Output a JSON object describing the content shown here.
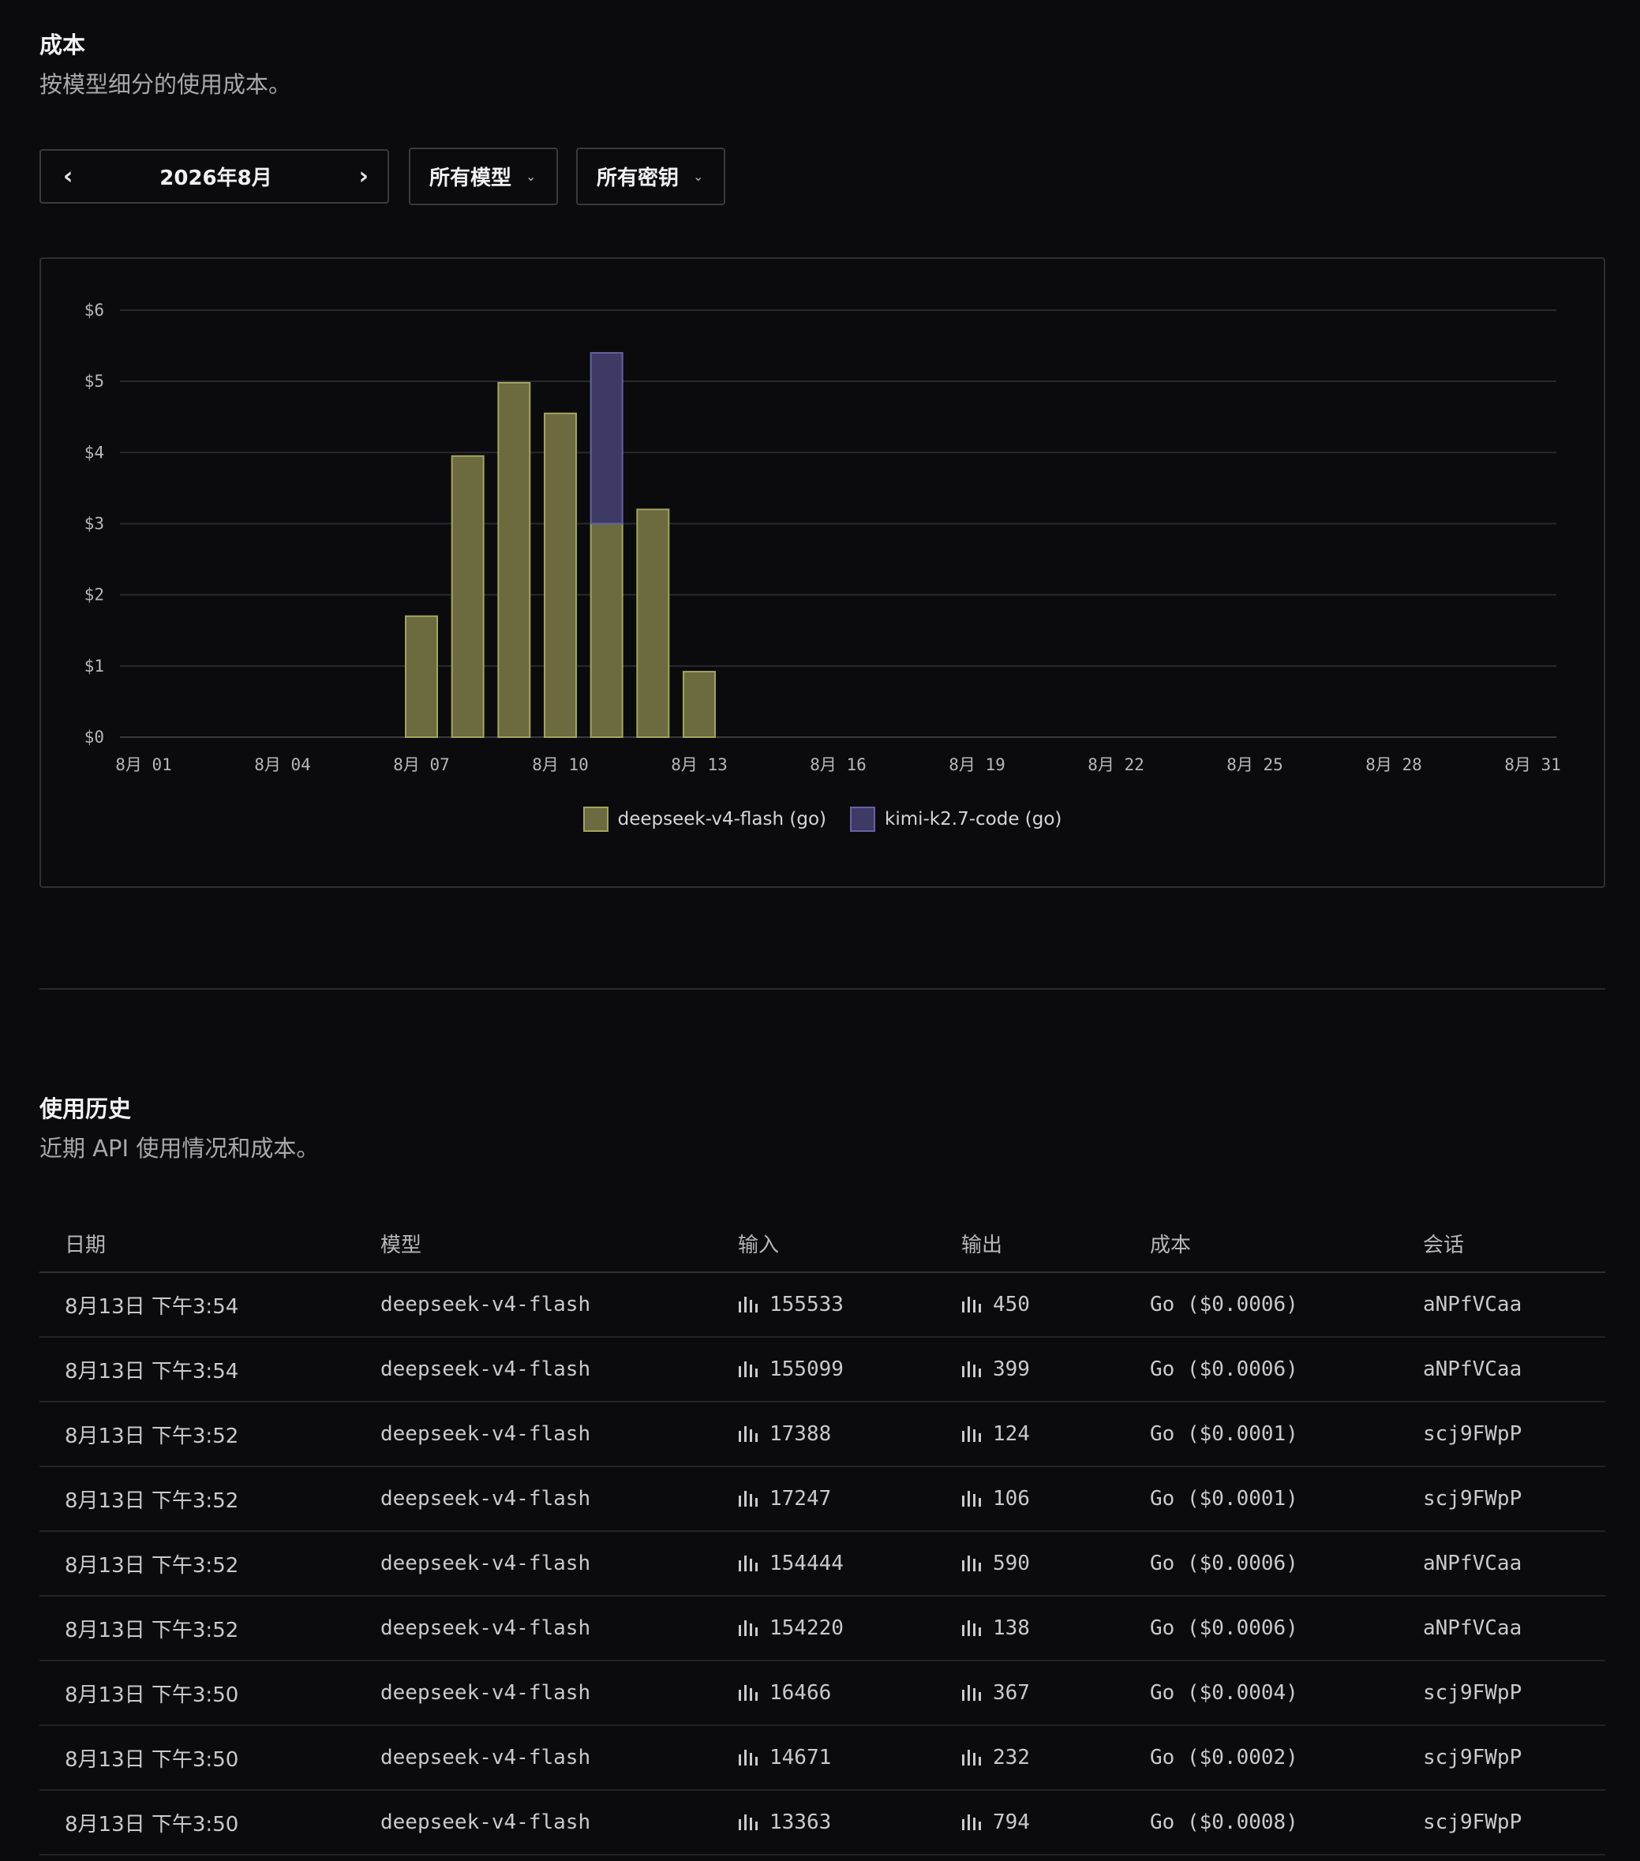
{
  "cost_section": {
    "title": "成本",
    "subtitle": "按模型细分的使用成本。"
  },
  "filters": {
    "month_label": "2026年8月",
    "prev_icon": "chevron-left-icon",
    "next_icon": "chevron-right-icon",
    "model_select": "所有模型",
    "key_select": "所有密钥",
    "caret_icon": "chevron-down-icon"
  },
  "chart_data": {
    "type": "bar",
    "stacked": true,
    "x": [
      "8月 01",
      "8月 02",
      "8月 03",
      "8月 04",
      "8月 05",
      "8月 06",
      "8月 07",
      "8月 08",
      "8月 09",
      "8月 10",
      "8月 11",
      "8月 12",
      "8月 13",
      "8月 14",
      "8月 15",
      "8月 16",
      "8月 17",
      "8月 18",
      "8月 19",
      "8月 20",
      "8月 21",
      "8月 22",
      "8月 23",
      "8月 24",
      "8月 25",
      "8月 26",
      "8月 27",
      "8月 28",
      "8月 29",
      "8月 30",
      "8月 31"
    ],
    "x_tick_labels": [
      "8月 01",
      "8月 04",
      "8月 07",
      "8月 10",
      "8月 13",
      "8月 16",
      "8月 19",
      "8月 22",
      "8月 25",
      "8月 28",
      "8月 31"
    ],
    "y_tick_labels": [
      "$0",
      "$1",
      "$2",
      "$3",
      "$4",
      "$5",
      "$6"
    ],
    "ylim": [
      0,
      6
    ],
    "grid": true,
    "legend_placement": "bottom-center",
    "series": [
      {
        "name": "deepseek-v4-flash (go)",
        "color": "#6b6b3f",
        "border": "#a3a45e",
        "values": [
          0,
          0,
          0,
          0,
          0,
          0,
          1.7,
          3.95,
          4.98,
          4.55,
          3.0,
          3.2,
          0.92,
          0,
          0,
          0,
          0,
          0,
          0,
          0,
          0,
          0,
          0,
          0,
          0,
          0,
          0,
          0,
          0,
          0,
          0
        ]
      },
      {
        "name": "kimi-k2.7-code (go)",
        "color": "#3d3b66",
        "border": "#6662a0",
        "values": [
          0,
          0,
          0,
          0,
          0,
          0,
          0,
          0,
          0,
          0,
          2.4,
          0,
          0,
          0,
          0,
          0,
          0,
          0,
          0,
          0,
          0,
          0,
          0,
          0,
          0,
          0,
          0,
          0,
          0,
          0,
          0
        ]
      }
    ]
  },
  "history_section": {
    "title": "使用历史",
    "subtitle": "近期 API 使用情况和成本。"
  },
  "table": {
    "headers": [
      "日期",
      "模型",
      "输入",
      "输出",
      "成本",
      "会话"
    ],
    "token_icon": "bar-chart-icon",
    "rows": [
      [
        "8月13日 下午3:54",
        "deepseek-v4-flash",
        "155533",
        "450",
        "Go ($0.0006)",
        "aNPfVCaa"
      ],
      [
        "8月13日 下午3:54",
        "deepseek-v4-flash",
        "155099",
        "399",
        "Go ($0.0006)",
        "aNPfVCaa"
      ],
      [
        "8月13日 下午3:52",
        "deepseek-v4-flash",
        "17388",
        "124",
        "Go ($0.0001)",
        "scj9FWpP"
      ],
      [
        "8月13日 下午3:52",
        "deepseek-v4-flash",
        "17247",
        "106",
        "Go ($0.0001)",
        "scj9FWpP"
      ],
      [
        "8月13日 下午3:52",
        "deepseek-v4-flash",
        "154444",
        "590",
        "Go ($0.0006)",
        "aNPfVCaa"
      ],
      [
        "8月13日 下午3:52",
        "deepseek-v4-flash",
        "154220",
        "138",
        "Go ($0.0006)",
        "aNPfVCaa"
      ],
      [
        "8月13日 下午3:50",
        "deepseek-v4-flash",
        "16466",
        "367",
        "Go ($0.0004)",
        "scj9FWpP"
      ],
      [
        "8月13日 下午3:50",
        "deepseek-v4-flash",
        "14671",
        "232",
        "Go ($0.0002)",
        "scj9FWpP"
      ],
      [
        "8月13日 下午3:50",
        "deepseek-v4-flash",
        "13363",
        "794",
        "Go ($0.0008)",
        "scj9FWpP"
      ]
    ]
  }
}
